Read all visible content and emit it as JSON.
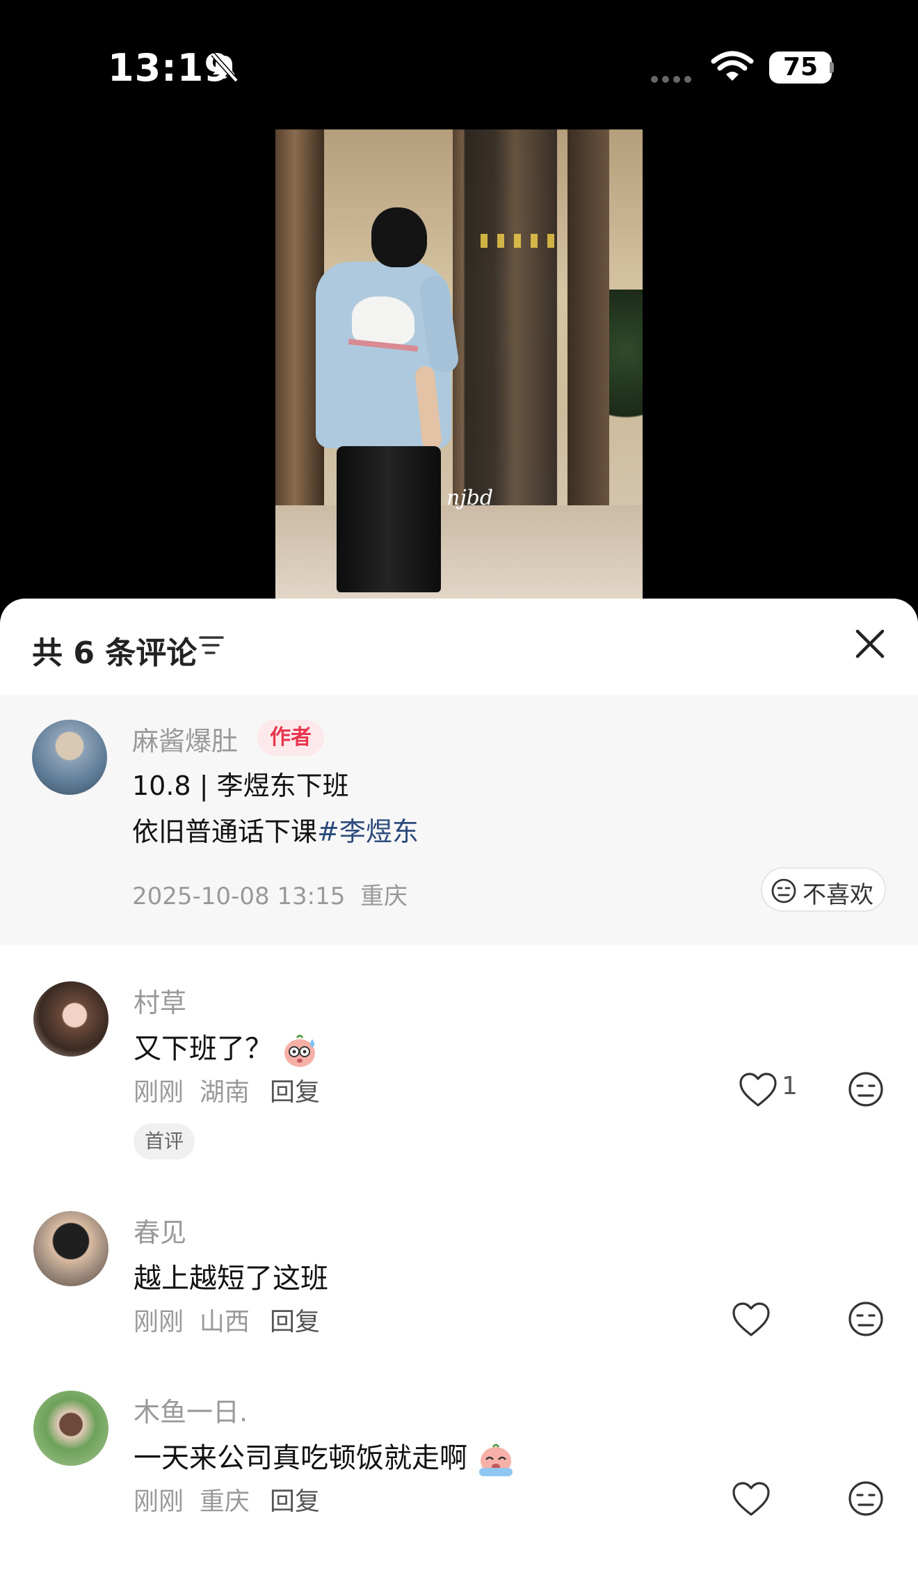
{
  "status_bar": {
    "time": "13:19",
    "battery": "75"
  },
  "video": {
    "watermark": "njbd"
  },
  "sheet": {
    "title": "共 6 条评论"
  },
  "author_post": {
    "name": "麻酱爆肚",
    "tag": "作者",
    "line1": "10.8 | 李煜东下班",
    "line2_text": "依旧普通话下课",
    "line2_hashtag": "#李煜东",
    "timestamp": "2025-10-08 13:15",
    "location": "重庆",
    "dislike_label": "不喜欢"
  },
  "comments": [
    {
      "name": "村草",
      "text": "又下班了？",
      "time": "刚刚",
      "location": "湖南",
      "reply_label": "回复",
      "likes": "1",
      "badge": "首评"
    },
    {
      "name": "春见",
      "text": "越上越短了这班",
      "time": "刚刚",
      "location": "山西",
      "reply_label": "回复"
    },
    {
      "name": "木鱼一日.",
      "text": "一天来公司真吃顿饭就走啊",
      "time": "刚刚",
      "location": "重庆",
      "reply_label": "回复"
    }
  ],
  "icons": {
    "bell": "bell-slash-icon",
    "wifi": "wifi-icon",
    "filter": "filter-icon",
    "close": "close-icon",
    "like": "heart-icon",
    "dislike": "neutral-face-icon"
  }
}
